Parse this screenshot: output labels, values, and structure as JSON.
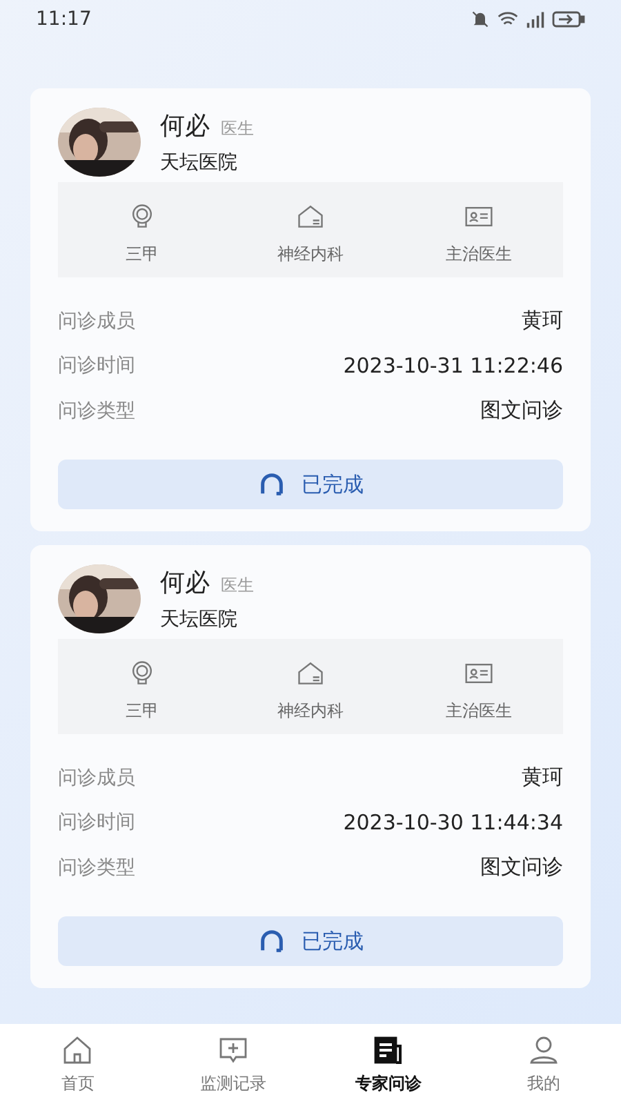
{
  "status_bar": {
    "time": "11:17"
  },
  "consultations": [
    {
      "doctor": {
        "name": "何必",
        "title": "医生",
        "hospital": "天坛医院"
      },
      "tags": [
        {
          "kind": "level",
          "label": "三甲"
        },
        {
          "kind": "department",
          "label": "神经内科"
        },
        {
          "kind": "rank",
          "label": "主治医生"
        }
      ],
      "fields": [
        {
          "label": "问诊成员",
          "value": "黄珂"
        },
        {
          "label": "问诊时间",
          "value": "2023-10-31 11:22:46"
        },
        {
          "label": "问诊类型",
          "value": "图文问诊"
        }
      ],
      "status": "已完成"
    },
    {
      "doctor": {
        "name": "何必",
        "title": "医生",
        "hospital": "天坛医院"
      },
      "tags": [
        {
          "kind": "level",
          "label": "三甲"
        },
        {
          "kind": "department",
          "label": "神经内科"
        },
        {
          "kind": "rank",
          "label": "主治医生"
        }
      ],
      "fields": [
        {
          "label": "问诊成员",
          "value": "黄珂"
        },
        {
          "label": "问诊时间",
          "value": "2023-10-30 11:44:34"
        },
        {
          "label": "问诊类型",
          "value": "图文问诊"
        }
      ],
      "status": "已完成"
    }
  ],
  "tab_bar": [
    {
      "kind": "home",
      "label": "首页",
      "selected": false
    },
    {
      "kind": "records",
      "label": "监测记录",
      "selected": false
    },
    {
      "kind": "consult",
      "label": "专家问诊",
      "selected": true
    },
    {
      "kind": "profile",
      "label": "我的",
      "selected": false
    }
  ]
}
